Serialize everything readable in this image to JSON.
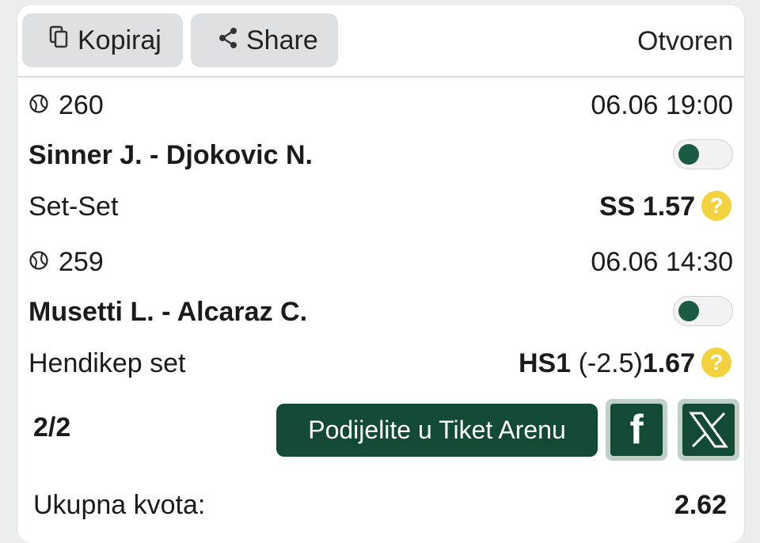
{
  "toolbar": {
    "copy_label": "Kopiraj",
    "share_label": "Share",
    "status": "Otvoren"
  },
  "bets": [
    {
      "number": "260",
      "datetime": "06.06 19:00",
      "match": "Sinner J. - Djokovic N.",
      "market": "Set-Set",
      "pick_code": "SS",
      "pick_extra": "",
      "odds": "1.57",
      "toggle_on": true
    },
    {
      "number": "259",
      "datetime": "06.06 14:30",
      "match": "Musetti L. - Alcaraz C.",
      "market": "Hendikep set",
      "pick_code": "HS1",
      "pick_extra": "(-2.5)",
      "odds": "1.67",
      "toggle_on": true
    }
  ],
  "footer": {
    "count": "2/2",
    "arena_label": "Podijelite u Tiket Arenu",
    "facebook_glyph": "f",
    "total_label": "Ukupna kvota:",
    "total_value": "2.62"
  },
  "colors": {
    "brand_green": "#124a35",
    "help_yellow": "#f3d33c",
    "toolbar_button_bg": "#dde1e3"
  },
  "icons": {
    "copy": "copy-icon",
    "share": "share-icon",
    "sport": "tennis-ball-icon",
    "help": "help-icon",
    "facebook": "facebook-icon",
    "x": "x-logo-icon"
  }
}
